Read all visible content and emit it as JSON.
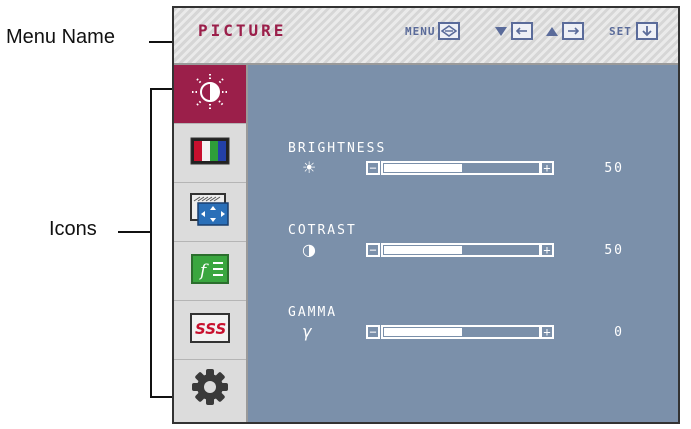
{
  "annotations": {
    "menu_name_label": "Menu Name",
    "icons_label": "Icons"
  },
  "osd": {
    "menu_name": "PICTURE",
    "hints": {
      "menu_text": "MENU",
      "set_text": "SET"
    },
    "sidebar": [
      {
        "name": "picture",
        "icon": "brightness-sun-icon",
        "active": true
      },
      {
        "name": "color",
        "icon": "color-bars-icon",
        "active": false
      },
      {
        "name": "display",
        "icon": "screen-position-icon",
        "active": false
      },
      {
        "name": "function",
        "icon": "function-icon",
        "active": false
      },
      {
        "name": "sss",
        "icon": "sss-icon",
        "active": false
      },
      {
        "name": "setup",
        "icon": "gear-icon",
        "active": false
      }
    ],
    "sliders": [
      {
        "label": "BRIGHTNESS",
        "icon_glyph": "☀",
        "value": "50",
        "level": 0.5
      },
      {
        "label": "COTRAST",
        "icon_glyph": "◑",
        "value": "50",
        "level": 0.5
      },
      {
        "label": "GAMMA",
        "icon_glyph": "γ",
        "value": "0",
        "level": 0.5
      }
    ]
  },
  "colors": {
    "accent": "#9b1f4a",
    "panel_bg": "#7b90aa",
    "sidebar_bg": "#dcdcdc",
    "hint_color": "#5a6b9a"
  }
}
